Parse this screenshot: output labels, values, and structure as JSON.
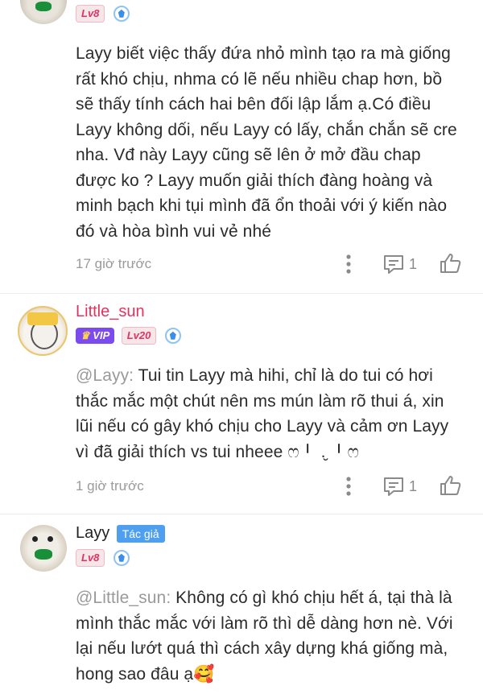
{
  "comments": [
    {
      "level": "Lv8",
      "text": "Layy biết việc thấy đứa nhỏ mình tạo ra mà giống rất khó chịu, nhma có lẽ nếu nhiều chap hơn, bồ sẽ thấy tính cách hai bên đối lập lắm ạ.Có điều Layy không dối, nếu Layy có lấy, chắn chắn sẽ cre nha. Vđ này Layy cũng sẽ lên ở mở đầu chap được ko ? Layy muốn giải thích đàng hoàng và minh bạch khi tụi mình đã ổn thoải với ý kiến nào đó và hòa bình vui vẻ nhé",
      "time": "17 giờ trước",
      "reply_count": "1"
    },
    {
      "username": "Little_sun",
      "vip": "VIP",
      "level": "Lv20",
      "mention": "@Layy:",
      "text": " Tui tin Layy mà hihi, chỉ là do tui có hơi thắc mắc một chút nên ms mún làm rõ thui á, xin lũi nếu có gây khó chịu cho Layy và cảm ơn Layy vì đã giải thích vs tui nheee ෆ╹ .̮ ╹ෆ",
      "time": "1 giờ trước",
      "reply_count": "1"
    },
    {
      "username": "Layy",
      "author_badge": "Tác giả",
      "level": "Lv8",
      "mention": "@Little_sun:",
      "text": " Không có gì khó chịu hết á, tại thà là mình thắc mắc với làm rõ thì dễ dàng hơn nè. Với lại nếu lướt quá thì cách xây dựng khá giống mà, hong sao đâu ạ🥰"
    }
  ],
  "colors": {
    "username_pink": "#e0335f",
    "author_blue": "#4f9ff0",
    "vip_purple": "#7b4bf0"
  }
}
